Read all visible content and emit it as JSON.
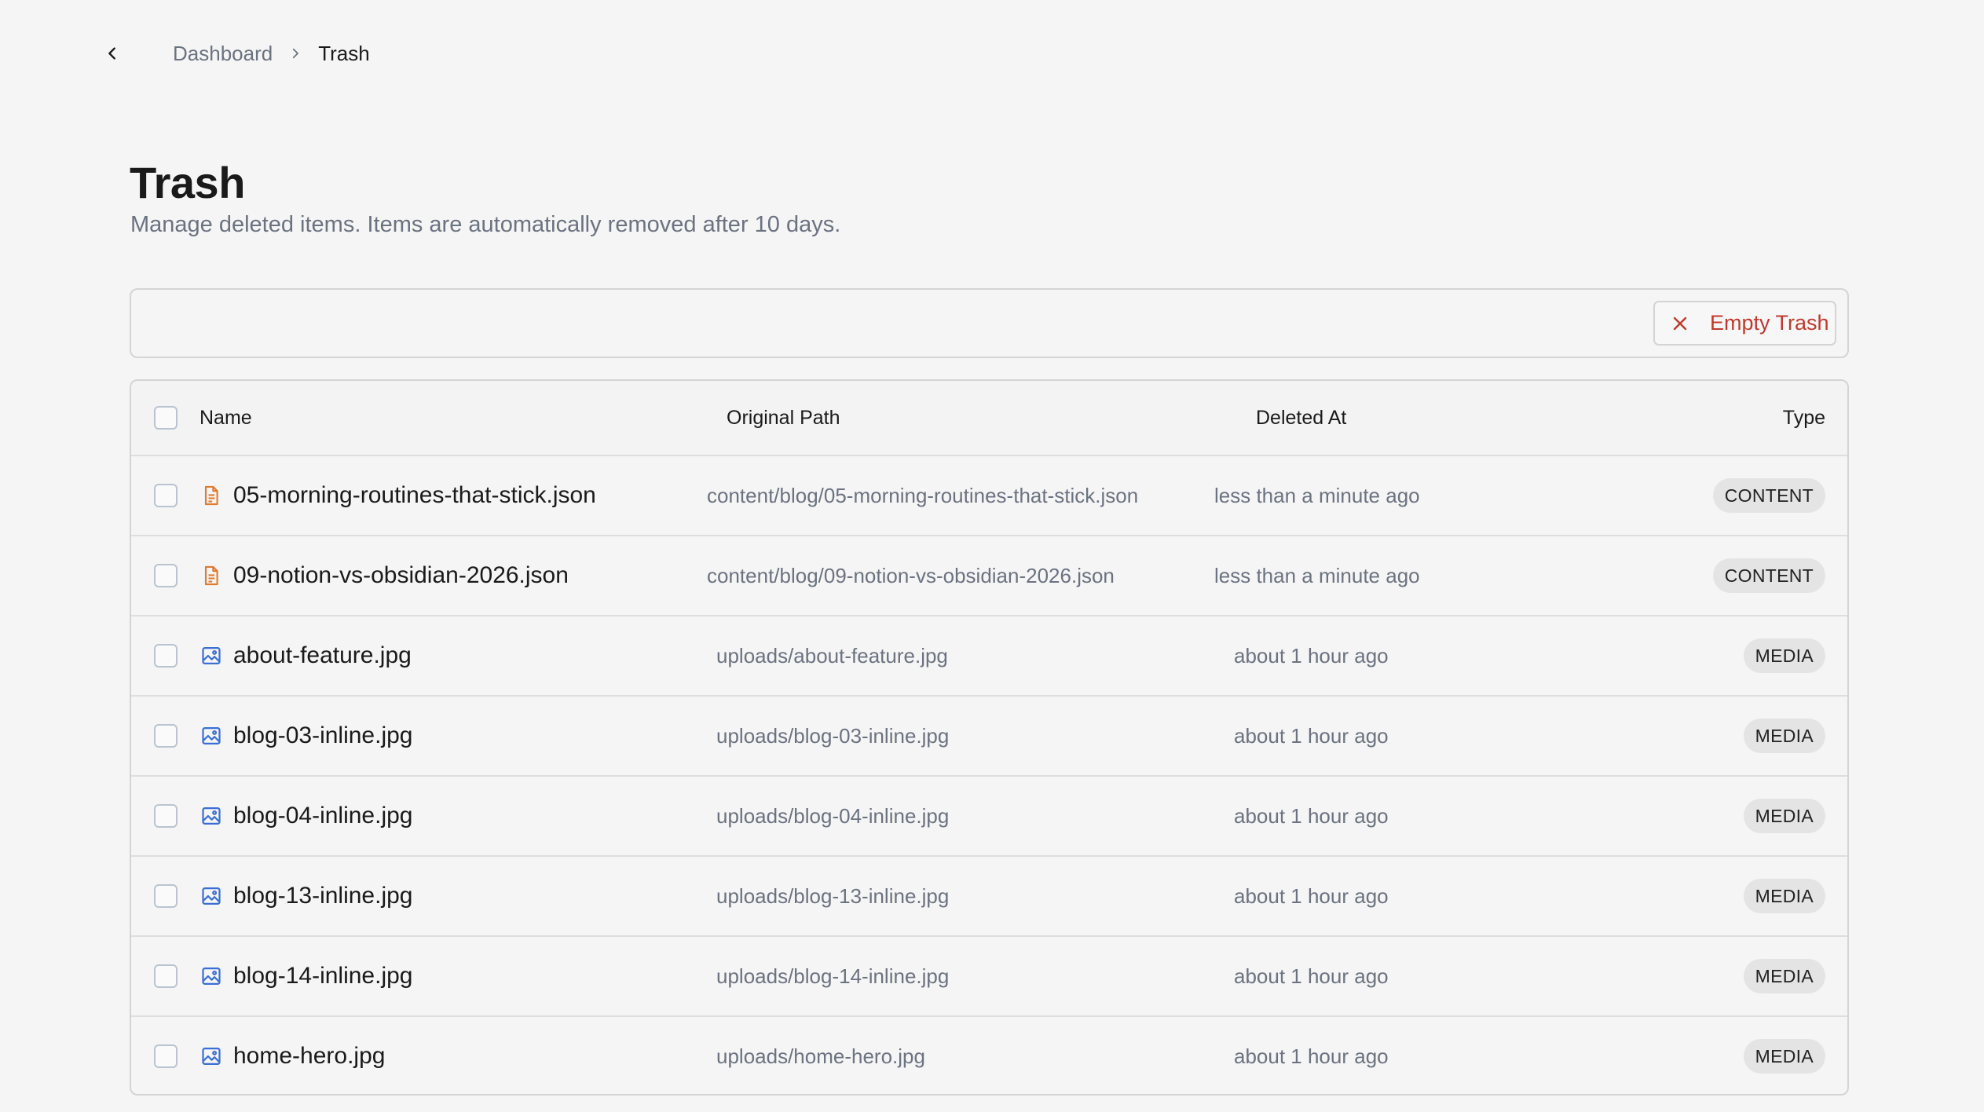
{
  "breadcrumb": {
    "back_icon": "chevron-left-icon",
    "parent": "Dashboard",
    "separator_icon": "chevron-right-icon",
    "current": "Trash"
  },
  "header": {
    "title": "Trash",
    "subtitle": "Manage deleted items. Items are automatically removed after 10 days."
  },
  "toolbar": {
    "empty_label": "Empty Trash",
    "empty_icon": "x-icon",
    "empty_color": "#c0392b"
  },
  "table": {
    "columns": [
      "Name",
      "Original Path",
      "Deleted At",
      "Type"
    ],
    "rows": [
      {
        "name": "05-morning-routines-that-stick.json",
        "path": "content/blog/05-morning-routines-that-stick.json",
        "deleted": "less than a minute ago",
        "type": "CONTENT",
        "icon": "document-icon"
      },
      {
        "name": "09-notion-vs-obsidian-2026.json",
        "path": "content/blog/09-notion-vs-obsidian-2026.json",
        "deleted": "less than a minute ago",
        "type": "CONTENT",
        "icon": "document-icon"
      },
      {
        "name": "about-feature.jpg",
        "path": "uploads/about-feature.jpg",
        "deleted": "about 1 hour ago",
        "type": "MEDIA",
        "icon": "image-icon"
      },
      {
        "name": "blog-03-inline.jpg",
        "path": "uploads/blog-03-inline.jpg",
        "deleted": "about 1 hour ago",
        "type": "MEDIA",
        "icon": "image-icon"
      },
      {
        "name": "blog-04-inline.jpg",
        "path": "uploads/blog-04-inline.jpg",
        "deleted": "about 1 hour ago",
        "type": "MEDIA",
        "icon": "image-icon"
      },
      {
        "name": "blog-13-inline.jpg",
        "path": "uploads/blog-13-inline.jpg",
        "deleted": "about 1 hour ago",
        "type": "MEDIA",
        "icon": "image-icon"
      },
      {
        "name": "blog-14-inline.jpg",
        "path": "uploads/blog-14-inline.jpg",
        "deleted": "about 1 hour ago",
        "type": "MEDIA",
        "icon": "image-icon"
      },
      {
        "name": "home-hero.jpg",
        "path": "uploads/home-hero.jpg",
        "deleted": "about 1 hour ago",
        "type": "MEDIA",
        "icon": "image-icon"
      }
    ]
  },
  "colors": {
    "document_icon": "#e07a2e",
    "image_icon": "#3b6fd8",
    "badge_bg": "#e4e4e4"
  }
}
